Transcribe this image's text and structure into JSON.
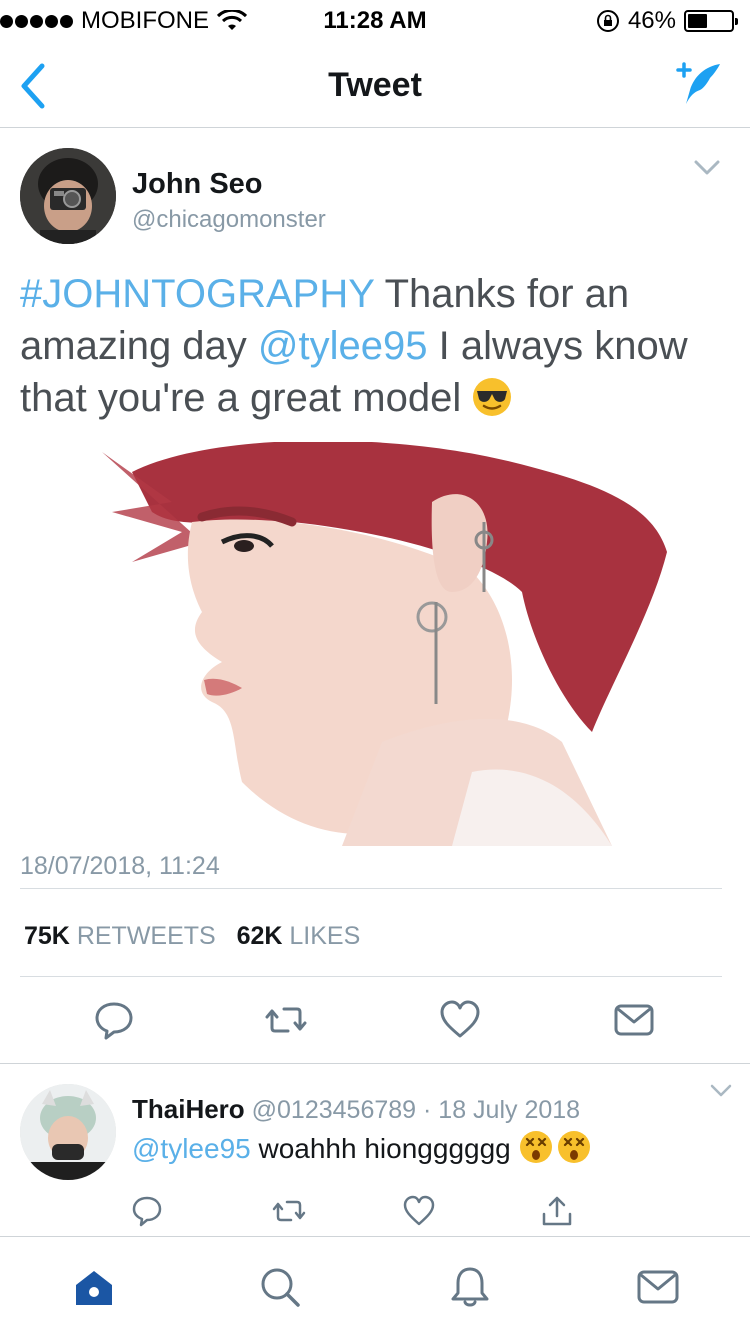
{
  "status_bar": {
    "carrier": "MOBIFONE",
    "time": "11:28 AM",
    "battery_percent": "46%",
    "battery_level": 0.46
  },
  "nav": {
    "title": "Tweet"
  },
  "tweet": {
    "author_name": "John Seo",
    "author_handle": "@chicagomonster",
    "hashtag": "#JOHNTOGRAPHY",
    "text_part1": " Thanks for an amazing day ",
    "mention": "@tylee95",
    "text_part2": "  I always know that you're a great model ",
    "emoji": "smiling-face-with-sunglasses",
    "timestamp": "18/07/2018, 11:24",
    "retweets_count": "75K",
    "retweets_label": "RETWEETS",
    "likes_count": "62K",
    "likes_label": "LIKES"
  },
  "reply": {
    "author_name": "ThaiHero",
    "author_handle": "@0123456789",
    "separator": "·",
    "date": "18 July 2018",
    "mention": "@tylee95",
    "text": " woahhh hiongggggg ",
    "emoji": "dizzy-face"
  },
  "colors": {
    "accent": "#1da1f2",
    "link": "#5ab0e8",
    "muted": "#8899a6",
    "tab_active": "#1b56a4"
  }
}
